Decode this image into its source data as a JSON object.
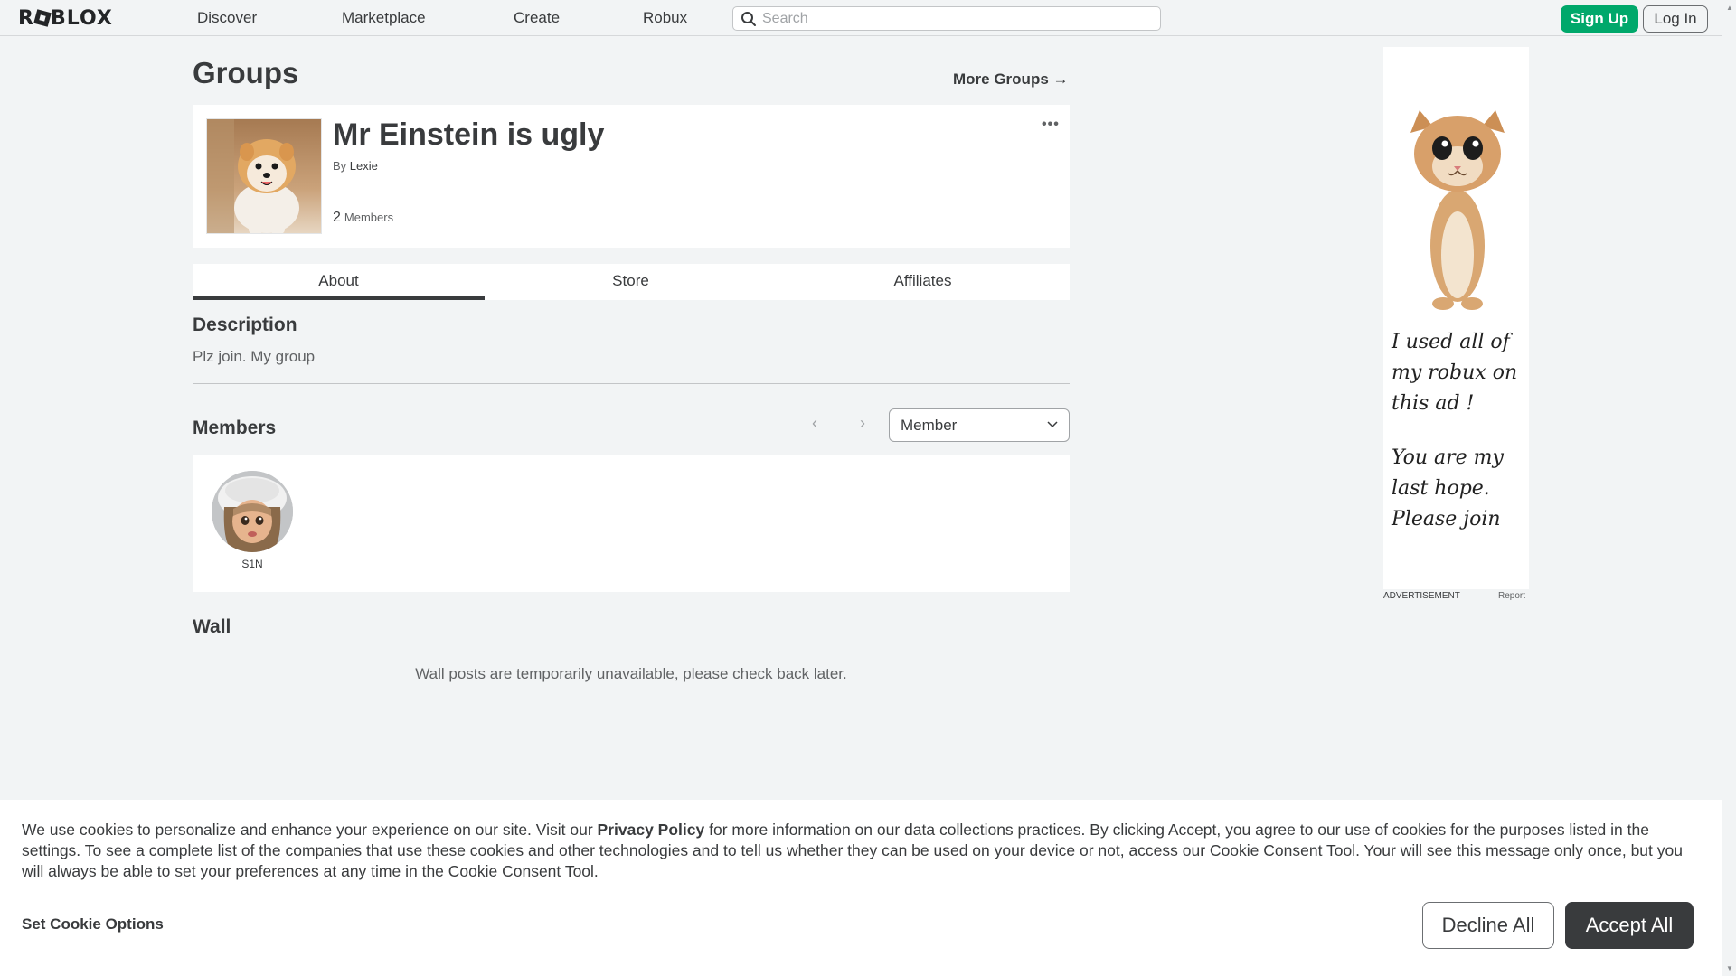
{
  "nav": {
    "logo": "ROBLOX",
    "links": [
      "Discover",
      "Marketplace",
      "Create",
      "Robux"
    ],
    "search_placeholder": "Search",
    "signup": "Sign Up",
    "login": "Log In"
  },
  "page": {
    "title": "Groups",
    "more_groups": "More Groups →"
  },
  "group": {
    "name": "Mr Einstein is ugly",
    "by_prefix": "By",
    "owner": "Lexie",
    "member_count": "2",
    "member_label": "Members",
    "menu": "•••"
  },
  "tabs": [
    "About",
    "Store",
    "Affiliates"
  ],
  "about": {
    "description_heading": "Description",
    "description": "Plz join. My group",
    "members_heading": "Members",
    "role_selected": "Member",
    "members": [
      {
        "name": "S1N"
      }
    ],
    "wall_heading": "Wall",
    "wall_message": "Wall posts are temporarily unavailable, please check back later."
  },
  "ad": {
    "lines1": [
      "I used all of",
      "my robux on",
      "this ad !"
    ],
    "lines2": [
      "You are my",
      "last hope.",
      "Please join"
    ],
    "label": "ADVERTISEMENT",
    "report": "Report"
  },
  "cookie": {
    "text_before": "We use cookies to personalize and enhance your experience on our site. Visit our ",
    "policy_link": "Privacy Policy",
    "text_after": " for more information on our data collections practices. By clicking Accept, you agree to our use of cookies for the purposes listed in the settings. To see a complete list of the companies that use these cookies and other technologies and to tell us whether they can be used on your device or not, access our Cookie Consent Tool. Your will see this message only once, but you will always be able to set your preferences at any time in the Cookie Consent Tool.",
    "set_options": "Set Cookie Options",
    "decline": "Decline All",
    "accept": "Accept All"
  },
  "colors": {
    "background": "#f2f4f5",
    "signup_green": "#00a86b",
    "accept_dark": "#393b3d",
    "text": "#393b3d"
  }
}
